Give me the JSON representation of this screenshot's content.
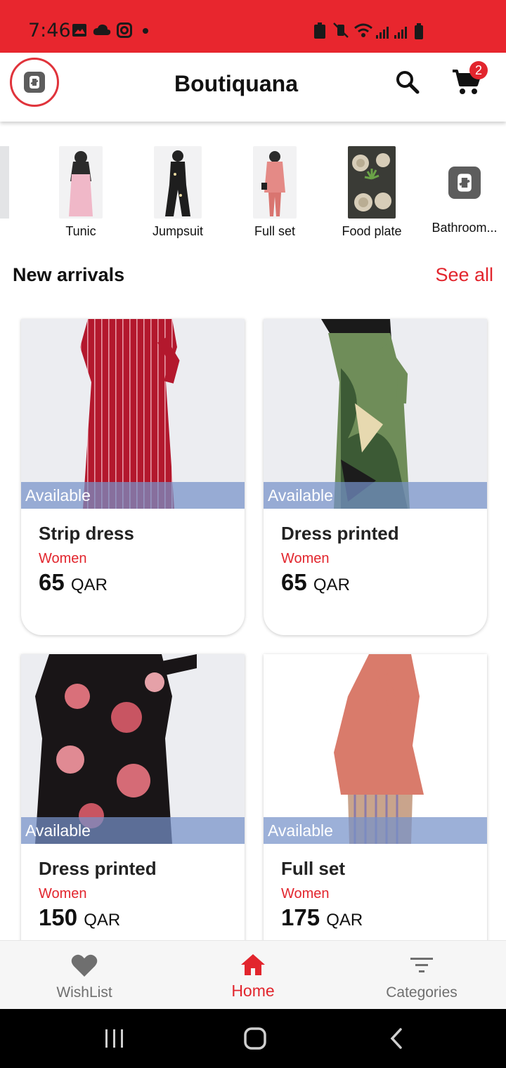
{
  "status_bar": {
    "time": "7:46",
    "bg_color": "#e8262e"
  },
  "app_bar": {
    "title": "Boutiquana",
    "cart_count": "2",
    "icons": [
      "logo-icon",
      "search-icon",
      "cart-icon"
    ]
  },
  "categories": [
    {
      "label": "Tunic"
    },
    {
      "label": "Jumpsuit"
    },
    {
      "label": "Full set"
    },
    {
      "label": "Food plate"
    },
    {
      "label": "Bathroom..."
    }
  ],
  "section": {
    "title": "New arrivals",
    "see_all": "See all"
  },
  "products": [
    {
      "badge": "Available",
      "name": "Strip dress",
      "category": "Women",
      "price": "65",
      "currency": "QAR"
    },
    {
      "badge": "Available",
      "name": "Dress printed",
      "category": "Women",
      "price": "65",
      "currency": "QAR"
    },
    {
      "badge": "Available",
      "name": "Dress printed",
      "category": "Women",
      "price": "150",
      "currency": "QAR"
    },
    {
      "badge": "Available",
      "name": "Full set",
      "category": "Women",
      "price": "175",
      "currency": "QAR"
    }
  ],
  "bottom_nav": [
    {
      "label": "WishList",
      "icon": "heart-icon"
    },
    {
      "label": "Home",
      "icon": "home-icon",
      "active": true
    },
    {
      "label": "Categories",
      "icon": "filter-icon"
    }
  ],
  "colors": {
    "accent": "#e2252d",
    "badge_overlay": "#7692c9"
  }
}
